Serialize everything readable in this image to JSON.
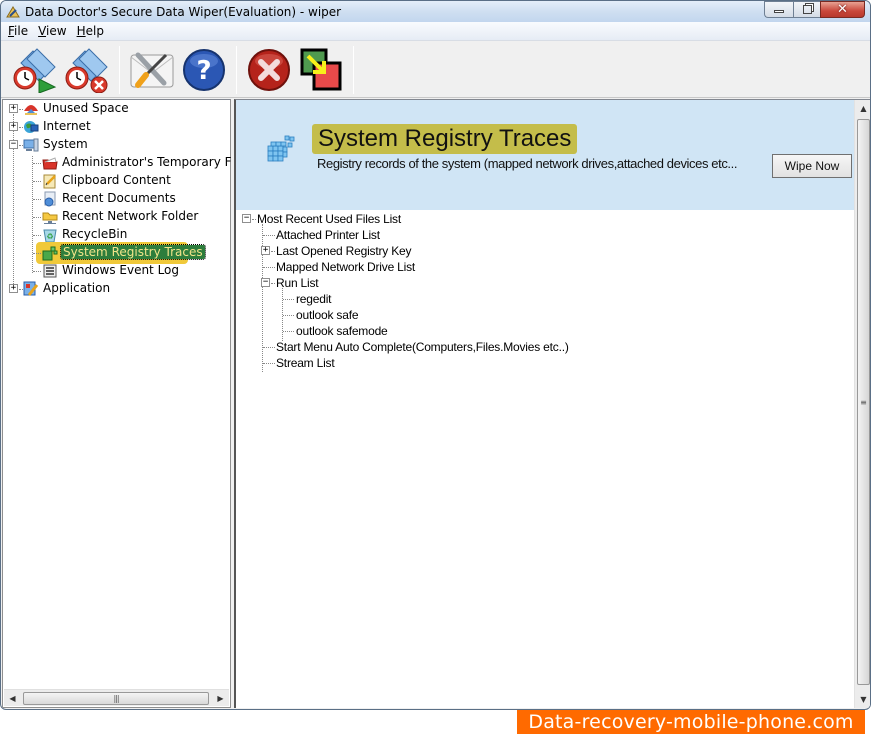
{
  "window": {
    "title": "Data Doctor's Secure Data Wiper(Evaluation) - wiper",
    "controls": {
      "minimize": "minimize",
      "maximize": "restore",
      "close": "close"
    }
  },
  "menu": [
    {
      "label": "File",
      "accel": "F"
    },
    {
      "label": "View",
      "accel": "V"
    },
    {
      "label": "Help",
      "accel": "H"
    }
  ],
  "toolbar": [
    {
      "name": "schedule-wipe",
      "icon": "folder-clock-play-icon"
    },
    {
      "name": "stop-schedule",
      "icon": "folder-clock-cancel-icon"
    },
    {
      "name": "settings",
      "icon": "tools-icon"
    },
    {
      "name": "help",
      "icon": "help-icon"
    },
    {
      "name": "exit",
      "icon": "exit-icon"
    },
    {
      "name": "switch-view",
      "icon": "switch-windows-icon"
    }
  ],
  "left_tree": {
    "items": [
      {
        "label": "Unused Space",
        "level": 0,
        "expander": "+",
        "icon": "unused-space-icon"
      },
      {
        "label": "Internet",
        "level": 0,
        "expander": "+",
        "icon": "internet-globe-icon"
      },
      {
        "label": "System",
        "level": 0,
        "expander": "-",
        "icon": "system-computer-icon"
      },
      {
        "label": "Administrator's Temporary Files",
        "level": 1,
        "icon": "folder-red-icon"
      },
      {
        "label": "Clipboard Content",
        "level": 1,
        "icon": "clipboard-icon"
      },
      {
        "label": "Recent Documents",
        "level": 1,
        "icon": "recent-documents-icon"
      },
      {
        "label": "Recent Network Folder",
        "level": 1,
        "icon": "network-folder-icon"
      },
      {
        "label": "RecycleBin",
        "level": 1,
        "icon": "recycle-bin-icon"
      },
      {
        "label": "System Registry Traces",
        "level": 1,
        "icon": "registry-icon",
        "selected": true
      },
      {
        "label": "Windows Event Log",
        "level": 1,
        "icon": "event-log-icon"
      },
      {
        "label": "Application",
        "level": 0,
        "expander": "+",
        "icon": "application-icon"
      }
    ]
  },
  "header": {
    "title": "System Registry Traces",
    "description": "Registry records of the system (mapped network drives,attached devices etc...",
    "wipe_button": "Wipe Now"
  },
  "right_tree": {
    "items": [
      {
        "label": "Most Recent Used Files List",
        "level": 0,
        "expander": "-"
      },
      {
        "label": "Attached Printer List",
        "level": 1
      },
      {
        "label": "Last Opened Registry Key",
        "level": 1,
        "expander": "+"
      },
      {
        "label": "Mapped Network Drive List",
        "level": 1
      },
      {
        "label": "Run List",
        "level": 1,
        "expander": "-"
      },
      {
        "label": "regedit",
        "level": 2
      },
      {
        "label": "outlook safe",
        "level": 2
      },
      {
        "label": "outlook safemode",
        "level": 2
      },
      {
        "label": "Start Menu Auto Complete(Computers,Files.Movies etc..)",
        "level": 1
      },
      {
        "label": "Stream List",
        "level": 1
      }
    ]
  },
  "watermark": "Data-recovery-mobile-phone.com",
  "colors": {
    "header_band": "#d0e5f5",
    "title_highlight": "#c4bd4a",
    "selected_bg": "#2d7d3c",
    "selected_text": "#f2e48a",
    "selected_glow": "#f0c93a",
    "watermark_bg": "#ff6a00"
  }
}
